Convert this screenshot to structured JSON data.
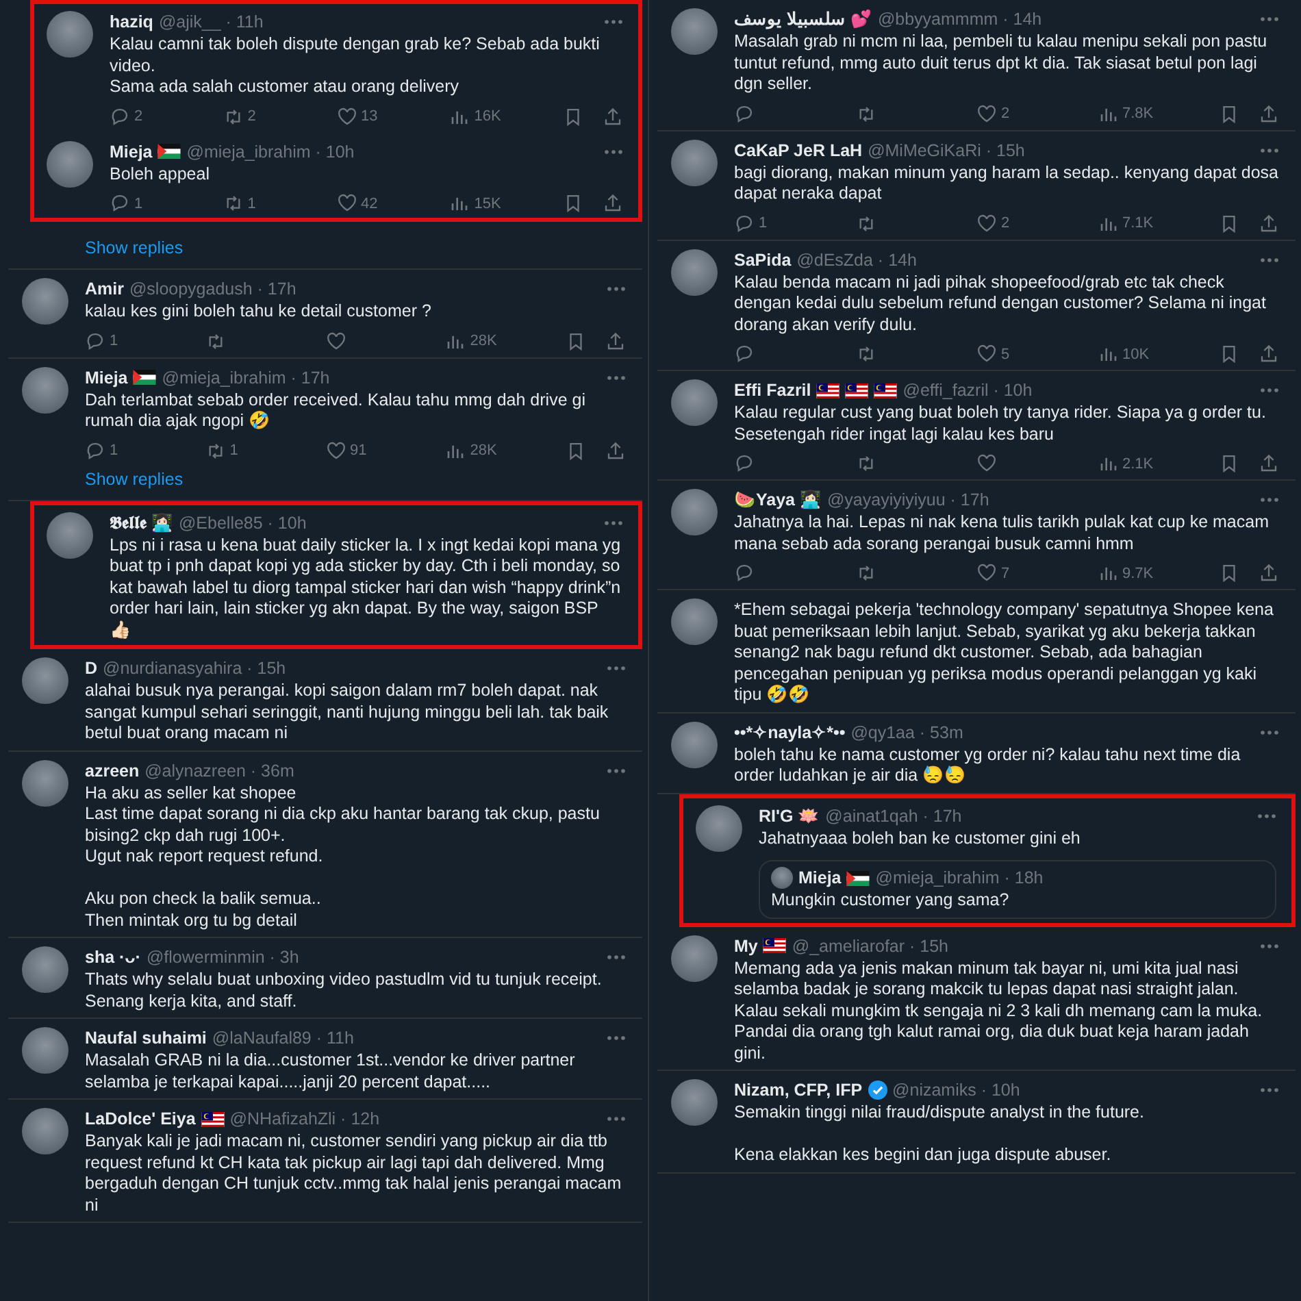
{
  "columns": [
    {
      "sections": [
        {
          "highlighted": true,
          "tweets": [
            {
              "name": "haziq",
              "meta": "@ajik__ · 11h",
              "text": "Kalau camni tak boleh dispute dengan grab ke? Sebab ada bukti video.\nSama ada salah customer atau orang delivery",
              "stats": {
                "replies": "2",
                "retweets": "2",
                "likes": "13",
                "views": "16K"
              }
            },
            {
              "name": "Mieja",
              "badges": [
                {
                  "kind": "palestine-flag"
                }
              ],
              "meta": "@mieja_ibrahim · 10h",
              "text": "Boleh appeal",
              "stats": {
                "replies": "1",
                "retweets": "1",
                "likes": "42",
                "views": "15K"
              }
            }
          ]
        },
        {
          "highlighted": false,
          "tweets": [
            {
              "show_replies": "Show replies"
            }
          ]
        },
        {
          "highlighted": false,
          "tweets": [
            {
              "name": "Amir",
              "meta": "@sloopygadush · 17h",
              "text": "kalau kes gini boleh tahu ke detail customer ?",
              "stats": {
                "replies": "1",
                "views": "28K"
              }
            },
            {
              "name": "Mieja",
              "badges": [
                {
                  "kind": "palestine-flag"
                }
              ],
              "meta": "@mieja_ibrahim · 17h",
              "text": "Dah terlambat sebab order received. Kalau tahu mmg dah drive gi rumah dia ajak ngopi 🤣",
              "stats": {
                "replies": "1",
                "retweets": "1",
                "likes": "91",
                "views": "28K"
              },
              "show_replies": "Show replies"
            }
          ]
        },
        {
          "highlighted": true,
          "tweets": [
            {
              "name": "𝕭𝖊𝖑𝖑𝖊 👩🏻‍💻",
              "meta": "@Ebelle85 · 10h",
              "text": "Lps ni i rasa u kena buat daily sticker la. I x ingt kedai kopi mana yg buat tp i pnh dapat kopi yg ada sticker by day. Cth i beli monday, so kat bawah label tu diorg tampal sticker hari dan wish “happy drink”n order hari lain, lain sticker yg akn dapat. By the way, saigon BSP 👍🏻"
            }
          ]
        },
        {
          "highlighted": false,
          "tweets": [
            {
              "name": "D",
              "meta": "@nurdianasyahira · 15h",
              "text": "alahai busuk nya perangai. kopi saigon dalam rm7 boleh dapat. nak sangat kumpul sehari seringgit, nanti hujung minggu beli lah. tak baik betul buat orang macam ni"
            },
            {
              "name": "azreen",
              "meta": "@alynazreen · 36m",
              "text": "Ha aku as seller kat shopee\nLast time dapat sorang ni dia ckp aku hantar barang tak ckup, pastu bising2 ckp dah rugi 100+.\nUgut nak report request refund.\n\nAku pon check la balik semua..\nThen mintak org tu bg detail"
            },
            {
              "name": "sha ·ᴗ·",
              "meta": "@flowerminmin · 3h",
              "text": "Thats why selalu buat unboxing video pastudlm vid tu tunjuk receipt.\nSenang kerja kita, and staff."
            },
            {
              "name": "Naufal suhaimi",
              "meta": "@laNaufal89 · 11h",
              "text": "Masalah GRAB ni la dia...customer 1st...vendor ke driver partner selamba je terkapai kapai.....janji 20 percent dapat....."
            },
            {
              "name": "LaDolce' Eiya",
              "badges": [
                {
                  "kind": "malaysia-flag"
                }
              ],
              "meta": "@NHafizahZli · 12h",
              "text": "Banyak kali je jadi macam ni, customer sendiri yang pickup air dia ttb request refund kt CH kata tak pickup air lagi tapi dah delivered. Mmg bergaduh dengan CH tunjuk cctv..mmg tak halal jenis perangai macam ni"
            }
          ]
        }
      ]
    },
    {
      "sections": [
        {
          "highlighted": false,
          "tweets": [
            {
              "name": "سلسبيلا يوسف 💕",
              "meta": "@bbyyammmm · 14h",
              "text": "Masalah grab ni mcm ni laa, pembeli tu kalau menipu sekali pon pastu tuntut refund, mmg auto duit terus dpt kt dia. Tak siasat betul pon lagi dgn seller.",
              "stats": {
                "likes": "2",
                "views": "7.8K"
              }
            },
            {
              "name": "CaKaP JeR LaH",
              "meta": "@MiMeGiKaRi · 15h",
              "text": "bagi diorang, makan minum yang haram la sedap.. kenyang dapat dosa dapat neraka dapat",
              "stats": {
                "replies": "1",
                "likes": "2",
                "views": "7.1K"
              }
            },
            {
              "name": "SaPida",
              "meta": "@dEsZda · 14h",
              "text": "Kalau benda macam ni jadi pihak shopeefood/grab etc tak check dengan kedai dulu sebelum refund dengan customer? Selama ni ingat dorang akan verify dulu.",
              "stats": {
                "likes": "5",
                "views": "10K"
              }
            },
            {
              "name": "Effi Fazril",
              "badges": [
                {
                  "kind": "malaysia-flag"
                },
                {
                  "kind": "malaysia-flag"
                },
                {
                  "kind": "malaysia-flag"
                }
              ],
              "meta": "@effi_fazril · 10h",
              "text": "Kalau regular cust yang buat boleh try tanya rider. Siapa ya g order tu.\nSesetengah rider ingat lagi kalau kes baru",
              "stats": {
                "views": "2.1K"
              }
            },
            {
              "name": "🍉Yaya 👩🏻‍💻",
              "meta": "@yayayiyiyiyuu · 17h",
              "text": "Jahatnya la hai. Lepas ni nak kena tulis tarikh pulak kat cup ke macam mana sebab ada sorang perangai busuk camni hmm",
              "stats": {
                "likes": "7",
                "views": "9.7K"
              }
            },
            {
              "text": "*Ehem sebagai pekerja 'technology company' sepatutnya Shopee kena buat pemeriksaan lebih lanjut. Sebab, syarikat yg aku bekerja takkan senang2 nak bagu refund dkt customer. Sebab, ada bahagian pencegahan penipuan yg periksa modus operandi pelanggan yg kaki tipu 🤣🤣"
            },
            {
              "name": "••*✧nayla✧*••",
              "meta": "@qy1aa · 53m",
              "text": "boleh tahu ke nama customer yg order ni? kalau tahu next time dia order ludahkan je air dia 😓😓"
            }
          ]
        },
        {
          "highlighted": true,
          "tweets": [
            {
              "name": "RI'G 🪷",
              "meta": "@ainat1qah · 17h",
              "text": "Jahatnyaaa boleh ban ke customer gini eh",
              "quote": {
                "name": "Mieja",
                "badges": [
                  {
                    "kind": "palestine-flag"
                  }
                ],
                "meta": "@mieja_ibrahim · 18h",
                "text": "Mungkin customer yang sama?"
              }
            }
          ]
        },
        {
          "highlighted": false,
          "tweets": [
            {
              "name": "My",
              "badges": [
                {
                  "kind": "malaysia-flag"
                }
              ],
              "meta": "@_ameliarofar · 15h",
              "text": "Memang ada ya jenis makan minum tak bayar ni, umi kita jual nasi selamba badak je sorang makcik tu lepas dapat nasi straight jalan. Kalau sekali mungkim tk sengaja ni 2 3 kali dh memang cam la muka. Pandai dia orang tgh kalut ramai org, dia duk buat keja haram jadah gini."
            },
            {
              "name": "Nizam, CFP, IFP",
              "badges": [
                {
                  "kind": "verified"
                }
              ],
              "meta": "@nizamiks · 10h",
              "text": "Semakin tinggi nilai fraud/dispute analyst in the future.\n\nKena elakkan kes begini dan juga dispute abuser."
            }
          ]
        }
      ]
    }
  ]
}
